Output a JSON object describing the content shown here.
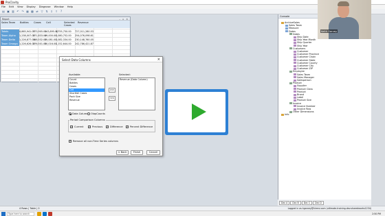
{
  "app": {
    "title": "ProClarity"
  },
  "menu": [
    "File",
    "Edit",
    "View",
    "Display",
    "Diagnose",
    "Window",
    "Help"
  ],
  "toolbar_icons": [
    "open-icon",
    "save-icon",
    "print-icon",
    "undo-icon",
    "redo-icon",
    "chart-icon",
    "grid-icon",
    "pivot-icon",
    "filter-icon",
    "sort-icon",
    "drill-icon",
    "export-icon",
    "help-icon"
  ],
  "report_window": {
    "title": "Report",
    "columns": [
      "Sales Team",
      "Bottles",
      "Cases",
      "Cell",
      "Selected Cases",
      "Revenue"
    ],
    "rows": [
      {
        "label": "Totals",
        "values": [
          "4,865,941.00",
          "773,905.00",
          "143,895.00",
          "1,755,750.00",
          "727,011,280.53"
        ]
      },
      {
        "label": "Team Alpha",
        "values": [
          "1,238,007.00",
          "271,833.00",
          "49,000.00",
          "1,080,752.00",
          "254,076,098.61"
        ]
      },
      {
        "label": "Team Delta",
        "values": [
          "1,226,877.00",
          "188,532.00",
          "35,081.00",
          "1,082,334.00",
          "230,148,760.05"
        ]
      },
      {
        "label": "Team Omega",
        "values": [
          "1,226,626.00",
          "276,501.00",
          "50,016.00",
          "1,152,644.00",
          "242,786,421.87"
        ]
      }
    ]
  },
  "dialog": {
    "title": "Select Data Columns",
    "available_label": "Available:",
    "selected_label": "Selected:",
    "available_items": [
      "Count",
      "Bottles",
      "Cases",
      "Cell",
      "Shortfall Cases",
      "Pack Size",
      "Revenue"
    ],
    "available_selected_index": 3,
    "selected_items": [
      "Revenue (Data Column)"
    ],
    "add_button": ">>",
    "remove_button": "<<",
    "radio_data_columns": "Data Columns",
    "radio_olap_counts": "OlapCounts",
    "group_label": "Period Comparison Columns",
    "check_current": "Current",
    "check_previous": "Previous",
    "check_difference": "Difference",
    "check_percent_difference": "Percent Difference",
    "remove_nontime_label": "Remove all non-Time Series columns",
    "back_button": "< Back",
    "finish_button": "Finish",
    "cancel_button": "Cancel"
  },
  "console": {
    "title": "Console",
    "tree": [
      {
        "label": "ArchiveSales",
        "depth": 0
      },
      {
        "label": "Sales Team",
        "depth": 1
      },
      {
        "label": "Measure",
        "depth": 1
      },
      {
        "label": "Dates",
        "depth": 1
      },
      {
        "label": "Dates",
        "depth": 2
      },
      {
        "label": "Ship Date",
        "depth": 3
      },
      {
        "label": "Ship Year-Month",
        "depth": 3
      },
      {
        "label": "Ship Quarter",
        "depth": 3
      },
      {
        "label": "Ship Year",
        "depth": 3
      },
      {
        "label": "Customers",
        "depth": 2
      },
      {
        "label": "Customer",
        "depth": 3
      },
      {
        "label": "Customer Province",
        "depth": 3
      },
      {
        "label": "Customer Chain",
        "depth": 3
      },
      {
        "label": "Customer State",
        "depth": 3
      },
      {
        "label": "Customer County",
        "depth": 3
      },
      {
        "label": "Customer City",
        "depth": 3
      },
      {
        "label": "Customer ZIP",
        "depth": 3
      },
      {
        "label": "Employee",
        "depth": 2
      },
      {
        "label": "Sales Team",
        "depth": 3
      },
      {
        "label": "Sales Manager",
        "depth": 3
      },
      {
        "label": "Salesperson",
        "depth": 3
      },
      {
        "label": "Product",
        "depth": 2
      },
      {
        "label": "Supplier",
        "depth": 3
      },
      {
        "label": "Product Class",
        "depth": 3
      },
      {
        "label": "Product",
        "depth": 3
      },
      {
        "label": "Brand",
        "depth": 3
      },
      {
        "label": "Label",
        "depth": 3
      },
      {
        "label": "Product Size",
        "depth": 3
      },
      {
        "label": "Invoice",
        "depth": 2
      },
      {
        "label": "Invoice Number",
        "depth": 3
      },
      {
        "label": "Invoice Row",
        "depth": 3
      },
      {
        "label": "Other Dimensions",
        "depth": 2
      },
      {
        "label": "Info",
        "depth": 0
      }
    ]
  },
  "webcam": {
    "name": "Keith Garvey"
  },
  "sheet_tabs": [
    "Dec A",
    "Dec B",
    "Dec C",
    "Dec D"
  ],
  "status": {
    "left": "4 Rows | Table | 0",
    "right": "Logged in as kgarvey@hirmsi.com (ultimate-training-dev.sharedworks1234)"
  },
  "taskbar": {
    "search_placeholder": "Type here to search",
    "time": "2:50 PM"
  },
  "colors": {
    "row_header": "#5f9fd6",
    "play_frame": "#2d80d4",
    "play_triangle": "#2eaa2e",
    "selection": "#3399ff"
  }
}
